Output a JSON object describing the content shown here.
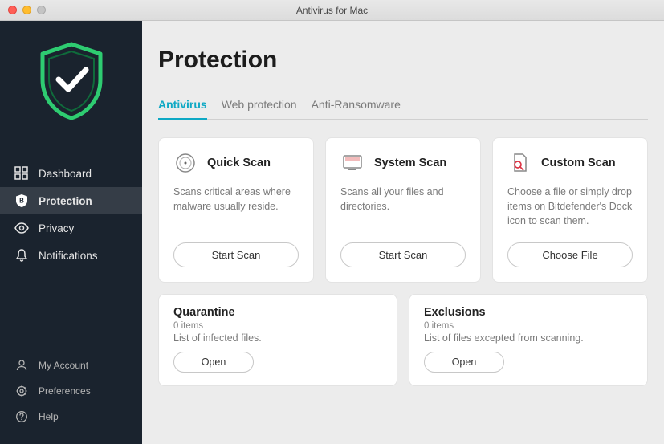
{
  "window": {
    "title": "Antivirus for Mac"
  },
  "sidebar": {
    "items": [
      {
        "label": "Dashboard"
      },
      {
        "label": "Protection"
      },
      {
        "label": "Privacy"
      },
      {
        "label": "Notifications"
      }
    ],
    "bottom": [
      {
        "label": "My Account"
      },
      {
        "label": "Preferences"
      },
      {
        "label": "Help"
      }
    ]
  },
  "page": {
    "title": "Protection"
  },
  "tabs": [
    {
      "label": "Antivirus"
    },
    {
      "label": "Web protection"
    },
    {
      "label": "Anti-Ransomware"
    }
  ],
  "cards": [
    {
      "title": "Quick Scan",
      "desc": "Scans critical areas where malware usually reside.",
      "button": "Start Scan"
    },
    {
      "title": "System Scan",
      "desc": "Scans all your files and directories.",
      "button": "Start Scan"
    },
    {
      "title": "Custom Scan",
      "desc": "Choose a file or simply drop items on Bitdefender's Dock icon to scan them.",
      "button": "Choose File"
    }
  ],
  "mini": [
    {
      "title": "Quarantine",
      "count": "0 items",
      "desc": "List of infected files.",
      "button": "Open"
    },
    {
      "title": "Exclusions",
      "count": "0 items",
      "desc": "List of files excepted from scanning.",
      "button": "Open"
    }
  ]
}
